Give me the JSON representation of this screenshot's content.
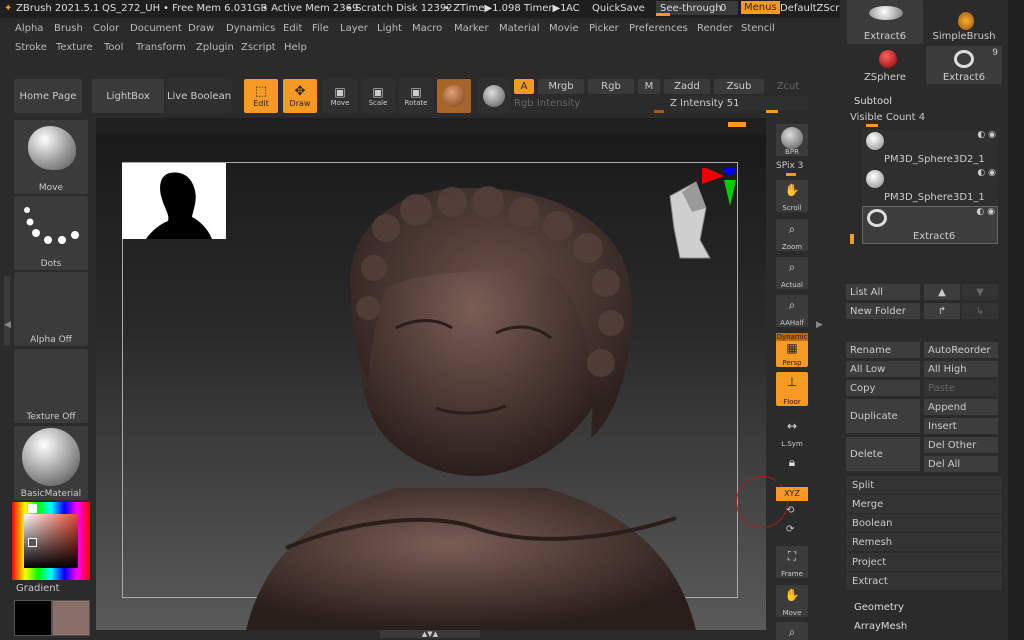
{
  "title": {
    "app": "ZBrush 2021.5.1",
    "doc": "QS_272_UH",
    "free_mem": "• Free Mem 6.031GB",
    "active_mem": "• Active Mem 2369",
    "scratch": "• Scratch Disk 12392",
    "ztime": "• ZTime▶1.098 Timer▶1",
    "ac": "AC",
    "quicksave": "QuickSave",
    "see_through": "See-through",
    "see_through_val": "0",
    "menus": "Menus",
    "script": "DefaultZScript"
  },
  "menu_row1": [
    "Alpha",
    "Brush",
    "Color",
    "Document",
    "Draw",
    "Dynamics",
    "Edit",
    "File",
    "Layer",
    "Light",
    "Macro",
    "Marker",
    "Material",
    "Movie",
    "Picker",
    "Preferences",
    "Render",
    "Stencil"
  ],
  "menu_row2": [
    "Stroke",
    "Texture",
    "Tool",
    "Transform",
    "Zplugin",
    "Zscript",
    "Help"
  ],
  "toolbar": {
    "home": "Home Page",
    "lightbox": "LightBox",
    "live_boolean": "Live Boolean",
    "edit": "Edit",
    "draw": "Draw",
    "move": "Move",
    "scale": "Scale",
    "rotate": "Rotate",
    "a": "A",
    "mrgb": "Mrgb",
    "rgb": "Rgb",
    "m": "M",
    "zadd": "Zadd",
    "zsub": "Zsub",
    "zcut": "Zcut",
    "rgb_intensity": "Rgb Intensity",
    "z_intensity": "Z Intensity 51"
  },
  "left_shelf": {
    "move": "Move",
    "dots": "Dots",
    "alpha": "Alpha Off",
    "texture": "Texture Off",
    "material": "BasicMaterial",
    "gradient": "Gradient"
  },
  "right_shelf": {
    "bpr": "BPR",
    "spix": "SPix 3",
    "scroll": "Scroll",
    "zoom": "Zoom",
    "actual": "Actual",
    "aahalf": "AAHalf",
    "dynamic": "Dynamic",
    "persp": "Persp",
    "floor": "Floor",
    "lsym": "L.Sym",
    "xyz": "XYZ",
    "frame": "Frame",
    "move": "Move"
  },
  "tool_palette": {
    "extract6_top": "Extract6",
    "simplebrush": "SimpleBrush",
    "zsphere": "ZSphere",
    "extract6": "Extract6",
    "count": "9"
  },
  "subtool": {
    "header": "Subtool",
    "visible_count": "Visible Count 4",
    "items": [
      "PM3D_Sphere3D2_1",
      "PM3D_Sphere3D1_1",
      "Extract6"
    ],
    "list_all": "List All",
    "new_folder": "New Folder",
    "rename": "Rename",
    "autoreorder": "AutoReorder",
    "all_low": "All Low",
    "all_high": "All High",
    "copy": "Copy",
    "paste": "Paste",
    "duplicate": "Duplicate",
    "append": "Append",
    "insert": "Insert",
    "delete": "Delete",
    "del_other": "Del Other",
    "del_all": "Del All",
    "sections": [
      "Split",
      "Merge",
      "Boolean",
      "Remesh",
      "Project",
      "Extract"
    ],
    "geometry": "Geometry",
    "arraymesh": "ArrayMesh"
  },
  "colors": {
    "accent": "#f59a23",
    "bg": "#2b2b2b"
  }
}
